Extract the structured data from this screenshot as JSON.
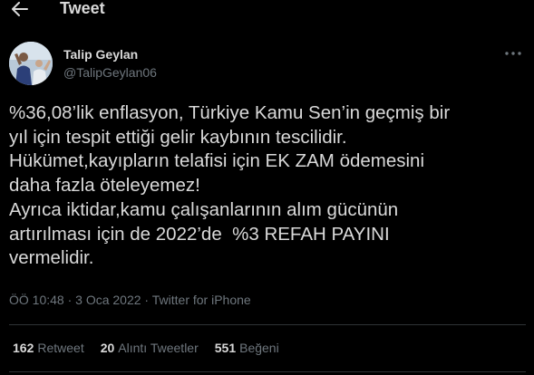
{
  "header": {
    "back_icon": "left-arrow-icon",
    "title": "Tweet"
  },
  "author": {
    "display_name": "Talip Geylan",
    "handle": "@TalipGeylan06",
    "avatar_icon": "profile-photo",
    "more_icon": "more-options-icon"
  },
  "tweet": {
    "lines": [
      "%36,08’lik enflasyon, Türkiye Kamu Sen’in geçmiş bir",
      "yıl için tespit ettiği gelir kaybının tescilidir.",
      "Hükümet,kayıpların telafisi için EK ZAM ödemesini",
      "daha fazla öteleyemez!",
      "Ayrıca iktidar,kamu çalışanlarının alım gücünün",
      "artırılması için de 2022’de  %3 REFAH PAYINI",
      "vermelidir."
    ]
  },
  "meta": {
    "time": "ÖÖ 10:48",
    "separator1": " · ",
    "date": "3 Oca 2022",
    "separator2": " · ",
    "source": "Twitter for iPhone"
  },
  "stats": {
    "retweets_count": "162",
    "retweets_label": "Retweet",
    "quotes_count": "20",
    "quotes_label": "Alıntı Tweetler",
    "likes_count": "551",
    "likes_label": "Beğeni"
  },
  "colors": {
    "background": "#000000",
    "text": "#d9d9d9",
    "muted": "#6e767d",
    "border": "#2f3336"
  }
}
